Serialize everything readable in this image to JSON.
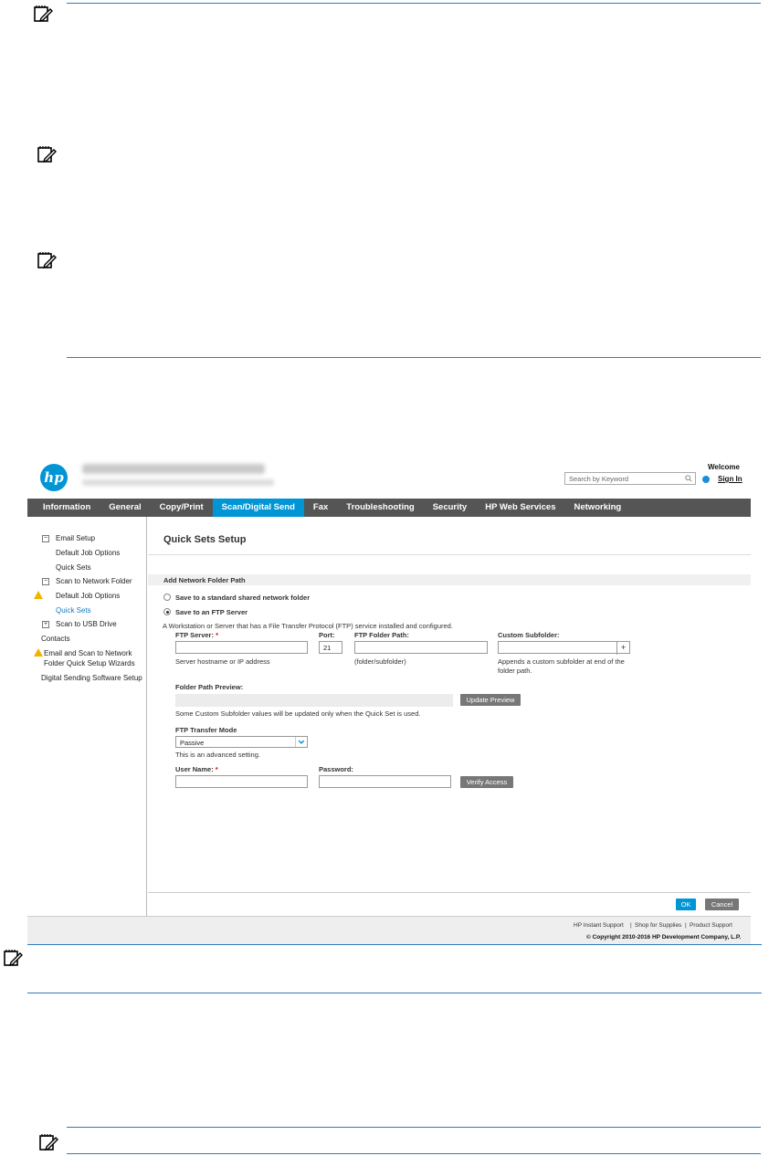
{
  "header": {
    "logo_text": "hp",
    "search_placeholder": "Search by Keyword",
    "welcome": "Welcome",
    "sign_in": "Sign In"
  },
  "nav": {
    "tabs": [
      {
        "label": "Information"
      },
      {
        "label": "General"
      },
      {
        "label": "Copy/Print"
      },
      {
        "label": "Scan/Digital Send"
      },
      {
        "label": "Fax"
      },
      {
        "label": "Troubleshooting"
      },
      {
        "label": "Security"
      },
      {
        "label": "HP Web Services"
      },
      {
        "label": "Networking"
      }
    ],
    "active": "Scan/Digital Send"
  },
  "sidebar": {
    "items": [
      {
        "label": "Email Setup",
        "expander": "−"
      },
      {
        "label": "Default Job Options"
      },
      {
        "label": "Quick Sets"
      },
      {
        "label": "Scan to Network Folder",
        "expander": "−"
      },
      {
        "label": "Default Job Options"
      },
      {
        "label": "Quick Sets"
      },
      {
        "label": "Scan to USB Drive",
        "expander": "+"
      },
      {
        "label": "Contacts"
      },
      {
        "label": "Email and Scan to Network"
      },
      {
        "label": "Folder Quick Setup Wizards"
      },
      {
        "label": "Digital Sending Software Setup"
      }
    ]
  },
  "main": {
    "title": "Quick Sets Setup",
    "section": "Add Network Folder Path",
    "radio_shared": "Save to a standard shared network folder",
    "radio_ftp": "Save to an FTP Server",
    "ftp_description": "A Workstation or Server that has a File Transfer Protocol (FTP) service installed and configured.",
    "ftp_server_label": "FTP Server:",
    "ftp_server_hint": "Server hostname or IP address",
    "port_label": "Port:",
    "port_value": "21",
    "folder_path_label": "FTP Folder Path:",
    "folder_path_hint": "(folder/subfolder)",
    "custom_subfolder_label": "Custom Subfolder:",
    "custom_subfolder_hint_1": "Appends a custom subfolder at end of the",
    "custom_subfolder_hint_2": "folder path.",
    "plus": "+",
    "preview_label": "Folder Path Preview:",
    "update_preview": "Update Preview",
    "preview_note": "Some Custom Subfolder values will be updated only when the Quick Set is used.",
    "transfer_mode_label": "FTP Transfer Mode",
    "transfer_mode_value": "Passive",
    "advanced_note": "This is an advanced setting.",
    "username_label": "User Name:",
    "password_label": "Password:",
    "verify_access": "Verify Access",
    "required_mark": "*",
    "ok": "OK",
    "cancel": "Cancel"
  },
  "footer": {
    "links": [
      "HP Instant Support",
      "Shop for Supplies",
      "Product Support"
    ],
    "separator": "|",
    "copyright": "© Copyright 2010-2016 HP Development Company, L.P."
  },
  "colors": {
    "rule": "#2c7cbf",
    "nav_bg": "#555555",
    "active_tab": "#0096d6",
    "ok_button": "#0096d6"
  }
}
